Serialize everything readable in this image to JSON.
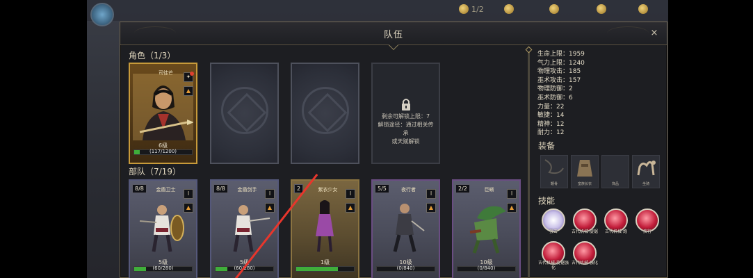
{
  "dialog": {
    "title": "队伍",
    "close": "×"
  },
  "roles_section": {
    "label": "角色（1/3）"
  },
  "hero_card": {
    "name": "司徒芒",
    "level": "6级",
    "xp": "(117/1200)",
    "xp_ratio": 0.1
  },
  "locked_card": {
    "line1": "剩余可解锁上限：7",
    "line2": "解锁途径：通过相关传承",
    "line3": "或天赋解锁"
  },
  "troops_section": {
    "label": "部队（7/19）"
  },
  "troops": [
    {
      "stack": "8/8",
      "name": "金盾卫士",
      "level": "5级",
      "xp": "(60/280)",
      "xp_ratio": 0.21
    },
    {
      "stack": "8/8",
      "name": "金盾剑手",
      "level": "5级",
      "xp": "(60/280)",
      "xp_ratio": 0.21
    },
    {
      "stack": "2",
      "name": "紫衣少女",
      "level": "1级",
      "xp": "",
      "xp_ratio": 0.72
    },
    {
      "stack": "5/5",
      "name": "夜行者",
      "level": "10级",
      "xp": "(0/840)",
      "xp_ratio": 0.0
    },
    {
      "stack": "2/2",
      "name": "巨蜥",
      "level": "10级",
      "xp": "(0/840)",
      "xp_ratio": 0.0
    }
  ],
  "stats": [
    "生命上限：1959",
    "气力上限：1240",
    "物理攻击：185",
    "巫术攻击：157",
    "物理防御：2",
    "巫术防御：6",
    "力量：22",
    "敏捷：14",
    "精神：12",
    "耐力：12"
  ],
  "equipment_section": {
    "label": "装备"
  },
  "equipment": [
    "鞭骨",
    "蛮族长衣",
    "饰品",
    "坐骑"
  ],
  "skills_section": {
    "label": "技能"
  },
  "skills": [
    {
      "label": "强击",
      "color": "white"
    },
    {
      "label": "古代机械·旋锯",
      "color": "red"
    },
    {
      "label": "古代机械·炮",
      "color": "red"
    },
    {
      "label": "疾行",
      "color": "red"
    },
    {
      "label": "古代机械·旋锯强化",
      "color": "red"
    },
    {
      "label": "古代机械·强化",
      "color": "red"
    }
  ],
  "background_bar": [
    "1/2",
    "",
    "",
    "",
    ""
  ]
}
